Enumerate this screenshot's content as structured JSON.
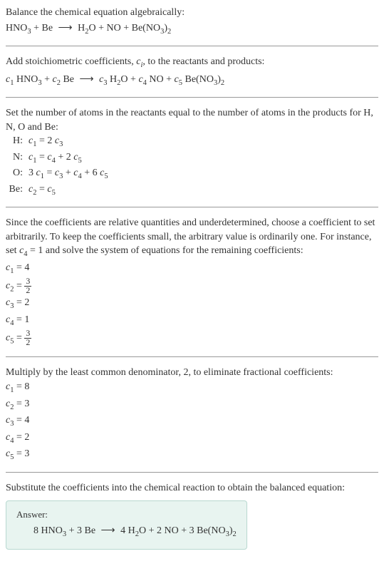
{
  "intro": {
    "line1": "Balance the chemical equation algebraically:",
    "equation": "HNO₃ + Be ⟶ H₂O + NO + Be(NO₃)₂"
  },
  "stoich": {
    "text": "Add stoichiometric coefficients, cᵢ, to the reactants and products:",
    "equation": "c₁ HNO₃ + c₂ Be ⟶ c₃ H₂O + c₄ NO + c₅ Be(NO₃)₂"
  },
  "atoms": {
    "text": "Set the number of atoms in the reactants equal to the number of atoms in the products for H, N, O and Be:",
    "rows": [
      {
        "label": "H:",
        "eq": "c₁ = 2 c₃"
      },
      {
        "label": "N:",
        "eq": "c₁ = c₄ + 2 c₅"
      },
      {
        "label": "O:",
        "eq": "3 c₁ = c₃ + c₄ + 6 c₅"
      },
      {
        "label": "Be:",
        "eq": "c₂ = c₅"
      }
    ]
  },
  "solve": {
    "text": "Since the coefficients are relative quantities and underdetermined, choose a coefficient to set arbitrarily. To keep the coefficients small, the arbitrary value is ordinarily one. For instance, set c₄ = 1 and solve the system of equations for the remaining coefficients:",
    "coeffs": [
      {
        "var": "c₁",
        "val": "4",
        "frac": false
      },
      {
        "var": "c₂",
        "val": "3/2",
        "frac": true,
        "num": "3",
        "den": "2"
      },
      {
        "var": "c₃",
        "val": "2",
        "frac": false
      },
      {
        "var": "c₄",
        "val": "1",
        "frac": false
      },
      {
        "var": "c₅",
        "val": "3/2",
        "frac": true,
        "num": "3",
        "den": "2"
      }
    ]
  },
  "multiply": {
    "text": "Multiply by the least common denominator, 2, to eliminate fractional coefficients:",
    "coeffs": [
      {
        "var": "c₁",
        "val": "8"
      },
      {
        "var": "c₂",
        "val": "3"
      },
      {
        "var": "c₃",
        "val": "4"
      },
      {
        "var": "c₄",
        "val": "2"
      },
      {
        "var": "c₅",
        "val": "3"
      }
    ]
  },
  "final": {
    "text": "Substitute the coefficients into the chemical reaction to obtain the balanced equation:",
    "answer_label": "Answer:",
    "answer_eq": "8 HNO₃ + 3 Be ⟶ 4 H₂O + 2 NO + 3 Be(NO₃)₂"
  },
  "chart_data": {
    "type": "table",
    "title": "Chemical equation balancing coefficients",
    "initial_solution": {
      "c1": 4,
      "c2": 1.5,
      "c3": 2,
      "c4": 1,
      "c5": 1.5
    },
    "final_solution": {
      "c1": 8,
      "c2": 3,
      "c3": 4,
      "c4": 2,
      "c5": 3
    },
    "atom_balance": [
      {
        "element": "H",
        "equation": "c1 = 2*c3"
      },
      {
        "element": "N",
        "equation": "c1 = c4 + 2*c5"
      },
      {
        "element": "O",
        "equation": "3*c1 = c3 + c4 + 6*c5"
      },
      {
        "element": "Be",
        "equation": "c2 = c5"
      }
    ]
  }
}
